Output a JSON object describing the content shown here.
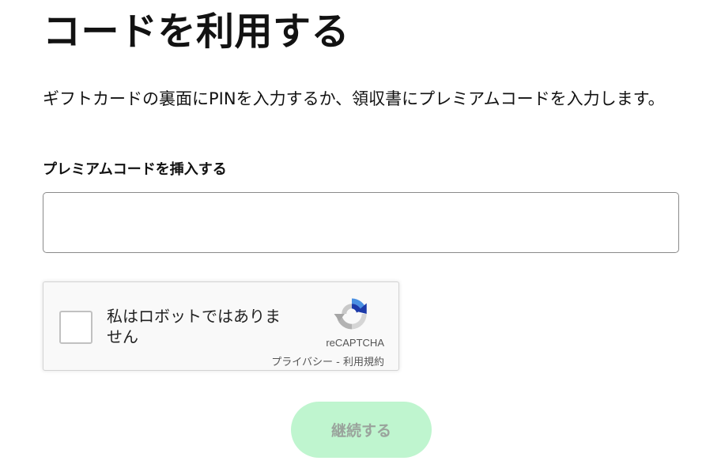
{
  "page": {
    "title": "コードを利用する",
    "description": "ギフトカードの裏面にPINを入力するか、領収書にプレミアムコードを入力します。"
  },
  "code_field": {
    "label": "プレミアムコードを挿入する",
    "value": "",
    "placeholder": ""
  },
  "recaptcha": {
    "checkbox_label": "私はロボットではありません",
    "checked": false,
    "brand": "reCAPTCHA",
    "privacy_label": "プライバシー",
    "separator": " - ",
    "terms_label": "利用規約",
    "logo_icon": "recaptcha-logo-icon",
    "colors": {
      "blue": "#1c3aa9",
      "light_blue": "#4a90e2",
      "gray": "#b3b3b3"
    }
  },
  "actions": {
    "continue_label": "継続する",
    "continue_disabled": true
  },
  "colors": {
    "button_bg_disabled": "#bff5cf",
    "button_text_disabled": "#9aa39c",
    "text": "#121212"
  }
}
